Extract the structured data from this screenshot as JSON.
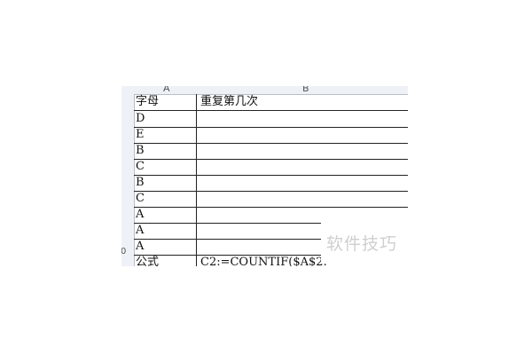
{
  "columns": {
    "a_label": "A",
    "b_label": "B"
  },
  "row_numbers": {
    "last": "0"
  },
  "header": {
    "col_a": "字母",
    "col_b": "重复第几次"
  },
  "rows": [
    {
      "a": "D",
      "b": ""
    },
    {
      "a": "E",
      "b": ""
    },
    {
      "a": "B",
      "b": ""
    },
    {
      "a": "C",
      "b": ""
    },
    {
      "a": "B",
      "b": ""
    },
    {
      "a": "C",
      "b": ""
    },
    {
      "a": "A",
      "b": ""
    },
    {
      "a": "A",
      "b": ""
    },
    {
      "a": "A",
      "b": ""
    }
  ],
  "formula_row": {
    "a": "公式",
    "b": "C2:=COUNTIF($A$2:"
  },
  "watermark": "软件技巧"
}
